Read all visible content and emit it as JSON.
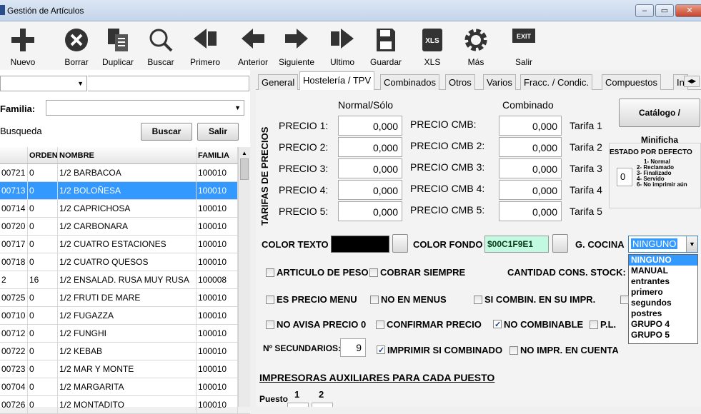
{
  "window": {
    "title": "Gestión de Artículos"
  },
  "toolbar": [
    {
      "label": "Nuevo",
      "icon": "plus-icon"
    },
    {
      "label": "Borrar",
      "icon": "delete-icon"
    },
    {
      "label": "Duplicar",
      "icon": "duplicate-icon"
    },
    {
      "label": "Buscar",
      "icon": "search-icon"
    },
    {
      "label": "Primero",
      "icon": "first-icon"
    },
    {
      "label": "Anterior",
      "icon": "previous-icon"
    },
    {
      "label": "Siguiente",
      "icon": "next-icon"
    },
    {
      "label": "Ultimo",
      "icon": "last-icon"
    },
    {
      "label": "Guardar",
      "icon": "save-icon"
    },
    {
      "label": "XLS",
      "icon": "xls-icon",
      "icon_text": "XLS"
    },
    {
      "label": "Más",
      "icon": "gear-icon"
    },
    {
      "label": "Salir",
      "icon": "exit-icon",
      "icon_text": "EXIT"
    }
  ],
  "left": {
    "familia_label": "Familia:",
    "busqueda_label": "Busqueda",
    "buscar_button": "Buscar",
    "salir_button": "Salir",
    "columns": [
      "",
      "ORDEN",
      "NOMBRE",
      "FAMILIA"
    ],
    "rows": [
      {
        "code": "00721",
        "orden": "0",
        "nombre": "1/2 BARBACOA",
        "familia": "100010"
      },
      {
        "code": "00713",
        "orden": "0",
        "nombre": "1/2 BOLOÑESA",
        "familia": "100010",
        "selected": true
      },
      {
        "code": "00714",
        "orden": "0",
        "nombre": "1/2 CAPRICHOSA",
        "familia": "100010"
      },
      {
        "code": "00720",
        "orden": "0",
        "nombre": "1/2 CARBONARA",
        "familia": "100010"
      },
      {
        "code": "00717",
        "orden": "0",
        "nombre": "1/2 CUATRO ESTACIONES",
        "familia": "100010"
      },
      {
        "code": "00718",
        "orden": "0",
        "nombre": "1/2 CUATRO QUESOS",
        "familia": "100010"
      },
      {
        "code": "2",
        "orden": "16",
        "nombre": "1/2 ENSALAD. RUSA MUY RUSA",
        "familia": "100008"
      },
      {
        "code": "00725",
        "orden": "0",
        "nombre": "1/2 FRUTI DE MARE",
        "familia": "100010"
      },
      {
        "code": "00710",
        "orden": "0",
        "nombre": "1/2 FUGAZZA",
        "familia": "100010"
      },
      {
        "code": "00712",
        "orden": "0",
        "nombre": "1/2 FUNGHI",
        "familia": "100010"
      },
      {
        "code": "00722",
        "orden": "0",
        "nombre": "1/2 KEBAB",
        "familia": "100010"
      },
      {
        "code": "00723",
        "orden": "0",
        "nombre": "1/2 MAR Y MONTE",
        "familia": "100010"
      },
      {
        "code": "00704",
        "orden": "0",
        "nombre": "1/2 MARGARITA",
        "familia": "100010"
      },
      {
        "code": "00726",
        "orden": "0",
        "nombre": "1/2 MONTADITO",
        "familia": "100010"
      }
    ]
  },
  "tabs": [
    "General",
    "Hostelería / TPV",
    "Combinados",
    "Otros",
    "Varios",
    "Fracc. / Condic.",
    "Compuestos",
    "In"
  ],
  "tabs_active": "Hostelería / TPV",
  "tarifas": {
    "vertical_label": "TARIFAS DE PRECIOS",
    "col_normal": "Normal/Sólo",
    "col_combinado": "Combinado",
    "rows": [
      {
        "label": "PRECIO 1:",
        "value": "0,000",
        "cmb_label": "PRECIO CMB:",
        "cmb_value": "0,000",
        "tarifa": "Tarifa 1"
      },
      {
        "label": "PRECIO 2:",
        "value": "0,000",
        "cmb_label": "PRECIO CMB 2:",
        "cmb_value": "0,000",
        "tarifa": "Tarifa 2"
      },
      {
        "label": "PRECIO 3:",
        "value": "0,000",
        "cmb_label": "PRECIO CMB 3:",
        "cmb_value": "0,000",
        "tarifa": "Tarifa 3"
      },
      {
        "label": "PRECIO 4:",
        "value": "0,000",
        "cmb_label": "PRECIO CMB 4:",
        "cmb_value": "0,000",
        "tarifa": "Tarifa 4"
      },
      {
        "label": "PRECIO 5:",
        "value": "0,000",
        "cmb_label": "PRECIO CMB 5:",
        "cmb_value": "0,000",
        "tarifa": "Tarifa 5"
      }
    ]
  },
  "catalogo_button": "Catálogo / Minificha",
  "estado": {
    "title": "ESTADO POR DEFECTO",
    "value": "0",
    "options": [
      "1- Normal",
      "2- Reclamado",
      "3- Finalizado",
      "4- Servido",
      "6- No imprimir aún"
    ]
  },
  "color_texto_label": "COLOR TEXTO",
  "color_texto_value": "#000000",
  "color_fondo_label": "COLOR FONDO",
  "color_fondo_value": "$00C1F9E1",
  "color_fondo_swatch": "#c1f9e1",
  "g_cocina_label": "G. COCINA",
  "g_cocina_value": "NINGUNO",
  "g_cocina_options": [
    "NINGUNO",
    "MANUAL",
    "entrantes",
    "primero",
    "segundos",
    "postres",
    "GRUPO 4",
    "GRUPO 5"
  ],
  "checks": {
    "articulo_peso": {
      "label": "ARTICULO DE PESO",
      "checked": false
    },
    "cobrar_siempre": {
      "label": "COBRAR SIEMPRE",
      "checked": false
    },
    "cantidad_cons_stock": "CANTIDAD CONS. STOCK:",
    "es_precio_menu": {
      "label": "ES PRECIO MENU",
      "checked": false
    },
    "no_en_menus": {
      "label": "NO EN MENUS",
      "checked": false
    },
    "si_combin": {
      "label": "SI COMBIN. EN SU IMPR.",
      "checked": false
    },
    "no_avisa": {
      "label": "NO AVISA PRECIO 0",
      "checked": false
    },
    "confirmar_precio": {
      "label": "CONFIRMAR PRECIO",
      "checked": false
    },
    "no_combinable": {
      "label": "NO COMBINABLE",
      "checked": true
    },
    "pl": {
      "label": "P.L.",
      "checked": false
    },
    "imprimir_si_combinado": {
      "label": "IMPRIMIR SI COMBINADO",
      "checked": true
    },
    "no_impr_cuenta": {
      "label": "NO IMPR. EN CUENTA",
      "checked": false
    }
  },
  "secundarios_label": "Nº SECUNDARIOS:",
  "secundarios_value": "9",
  "impresoras": {
    "title": "IMPRESORAS AUXILIARES PARA CADA PUESTO",
    "puesto_label": "Puesto",
    "puestos": [
      "1",
      "2"
    ]
  }
}
